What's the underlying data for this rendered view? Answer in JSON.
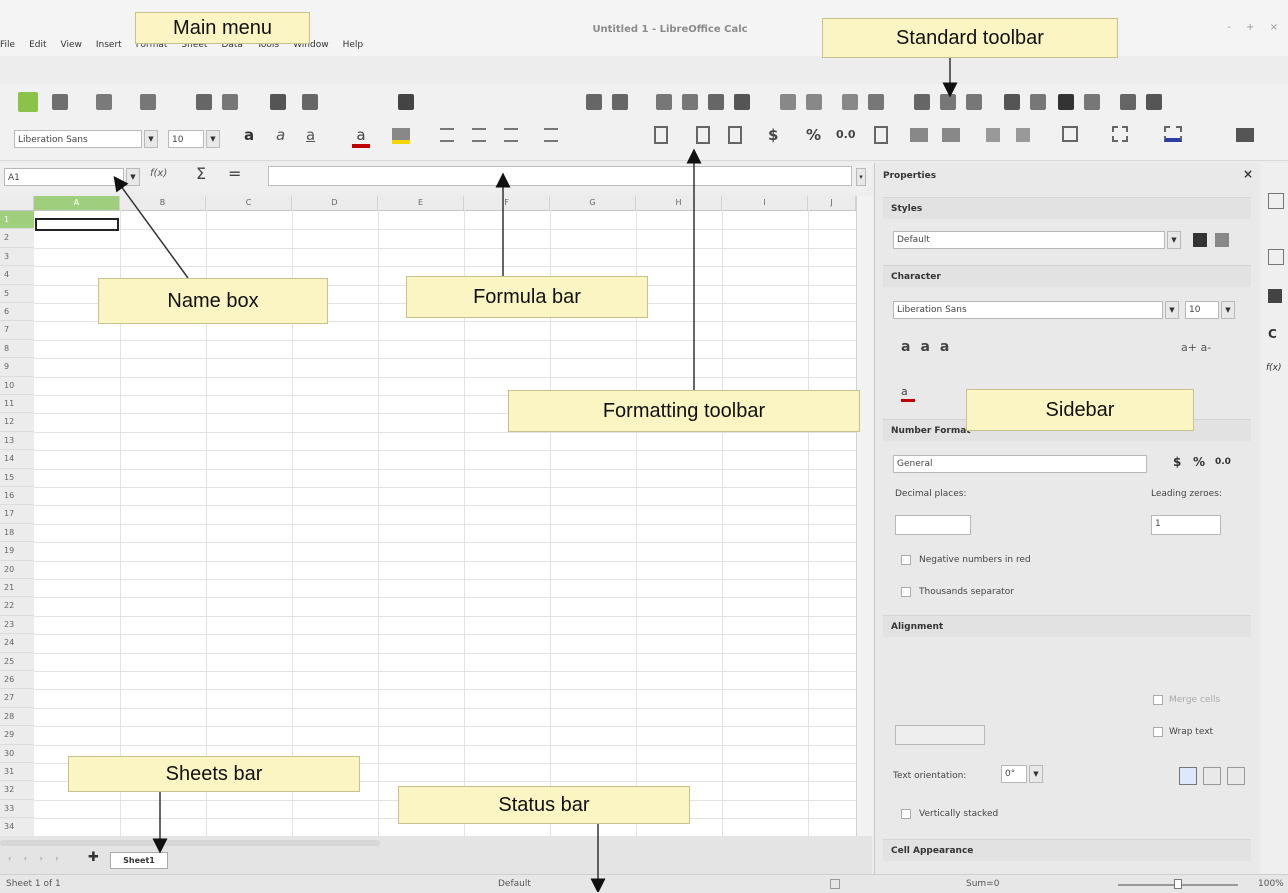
{
  "window": {
    "title": "Untitled 1 - LibreOffice Calc",
    "controls": "- + ×"
  },
  "menu": [
    "File",
    "Edit",
    "View",
    "Insert",
    "Format",
    "Sheet",
    "Data",
    "Tools",
    "Window",
    "Help"
  ],
  "formatting": {
    "font_name": "Liberation Sans",
    "font_size": "10",
    "currency": "$",
    "percent": "%",
    "decimal": "0.0"
  },
  "formula_bar": {
    "name_box": "A1",
    "fx": "f(x)",
    "sum": "Σ",
    "equals": "="
  },
  "grid": {
    "columns": [
      "A",
      "B",
      "C",
      "D",
      "E",
      "F",
      "G",
      "H",
      "I",
      "J"
    ],
    "rows": [
      "1",
      "2",
      "3",
      "4",
      "5",
      "6",
      "7",
      "8",
      "9",
      "10",
      "11",
      "12",
      "13",
      "14",
      "15",
      "16",
      "17",
      "18",
      "19",
      "20",
      "21",
      "22",
      "23",
      "24",
      "25",
      "26",
      "27",
      "28",
      "29",
      "30",
      "31",
      "32",
      "33",
      "34"
    ]
  },
  "sheets": {
    "tab": "Sheet1"
  },
  "status": {
    "sheet_info": "Sheet 1 of 1",
    "page_style": "Default",
    "sum": "Sum=0",
    "zoom": "100%"
  },
  "sidebar": {
    "title": "Properties",
    "styles": {
      "header": "Styles",
      "value": "Default"
    },
    "character": {
      "header": "Character",
      "font": "Liberation Sans",
      "size": "10"
    },
    "number_format": {
      "header": "Number Format",
      "category": "General",
      "currency": "$",
      "percent": "%",
      "decimal": "0.0",
      "decimal_places_label": "Decimal places:",
      "leading_zeroes_label": "Leading zeroes:",
      "leading_zeroes_value": "1",
      "negative_red": "Negative numbers in red",
      "thousands": "Thousands separator"
    },
    "alignment": {
      "header": "Alignment",
      "merge_cells": "Merge cells",
      "wrap_text": "Wrap text",
      "text_orientation_label": "Text orientation:",
      "orientation_value": "0°",
      "vertically_stacked": "Vertically stacked"
    },
    "cell_appearance": {
      "header": "Cell Appearance"
    }
  },
  "annotations": {
    "main_menu": "Main menu",
    "standard_toolbar": "Standard toolbar",
    "name_box": "Name box",
    "formula_bar": "Formula bar",
    "formatting_toolbar": "Formatting toolbar",
    "sidebar": "Sidebar",
    "sheets_bar": "Sheets bar",
    "status_bar": "Status bar"
  },
  "colors": {
    "accent_green": "#8bc34a",
    "annotation_fill": "#fbf5c3",
    "font_color_red": "#c00000",
    "highlight_yellow": "#f2d600"
  }
}
